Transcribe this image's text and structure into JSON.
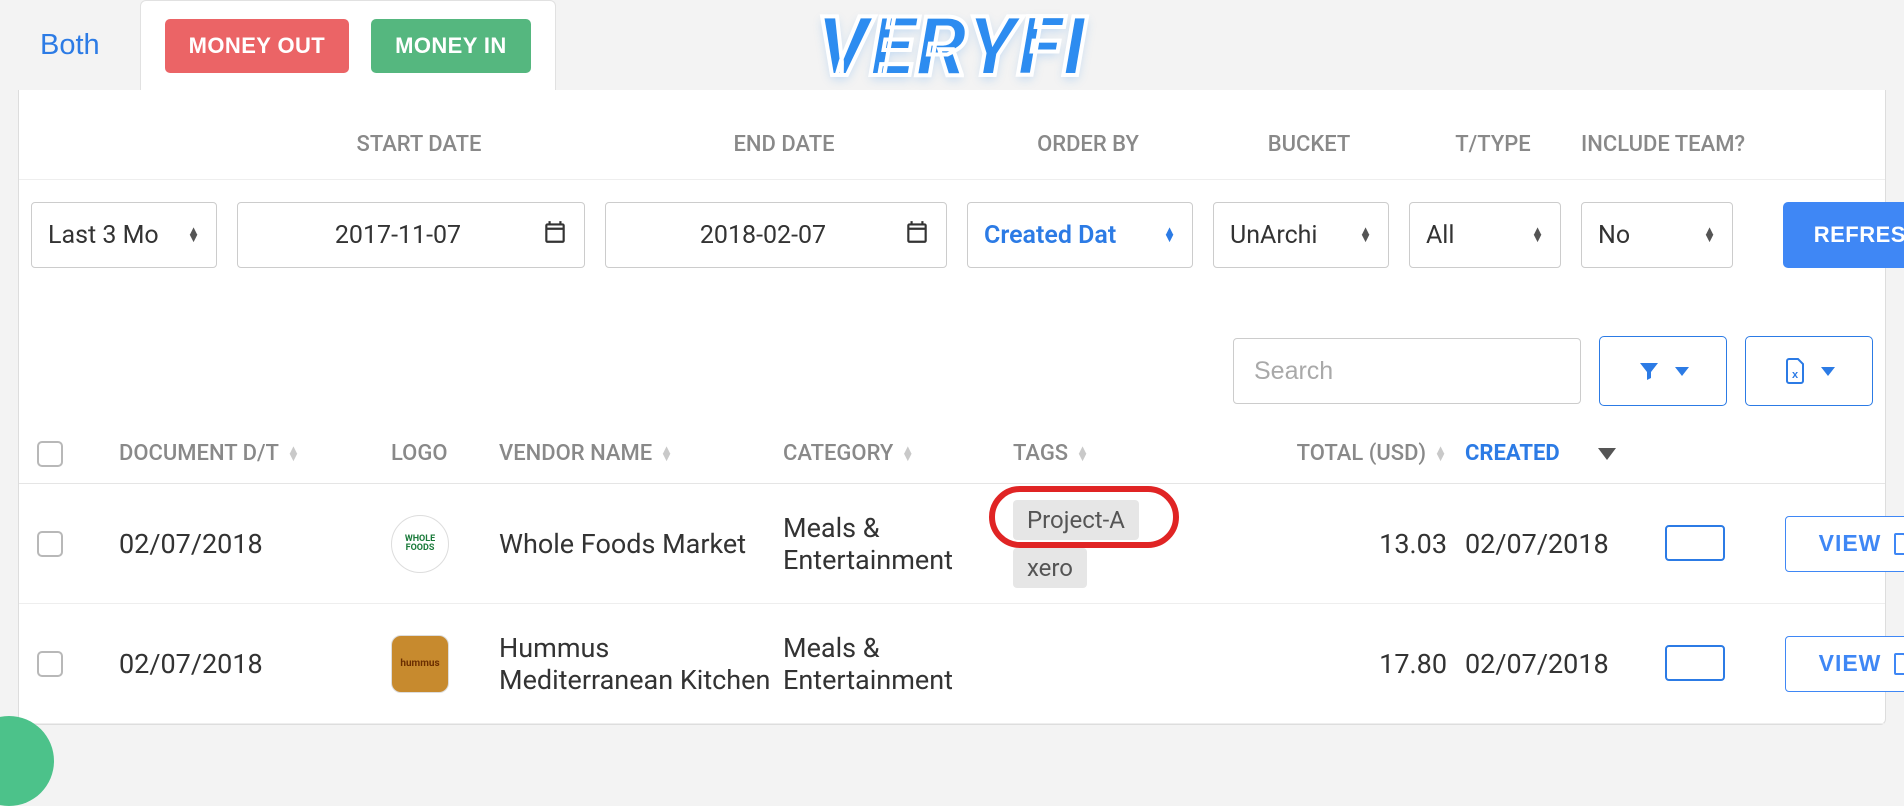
{
  "brand": "VERYFI",
  "tabs": {
    "both": "Both",
    "money_out": "MONEY OUT",
    "money_in": "MONEY IN"
  },
  "filters": {
    "labels": {
      "start_date": "START DATE",
      "end_date": "END DATE",
      "order_by": "ORDER BY",
      "bucket": "BUCKET",
      "ttype": "T/TYPE",
      "include_team": "INCLUDE TEAM?"
    },
    "range": "Last 3 Mo",
    "start_date": "2017-11-07",
    "end_date": "2018-02-07",
    "order_by": "Created Dat",
    "bucket": "UnArchi",
    "ttype": "All",
    "include_team": "No",
    "refresh": "REFRESH"
  },
  "search": {
    "placeholder": "Search"
  },
  "columns": {
    "document_dt": "DOCUMENT D/T",
    "logo": "LOGO",
    "vendor_name": "VENDOR NAME",
    "category": "CATEGORY",
    "tags": "TAGS",
    "total": "TOTAL (USD)",
    "created": "CREATED"
  },
  "rows": [
    {
      "date": "02/07/2018",
      "logo_text": "WHOLE FOODS",
      "logo_variant": "wf",
      "vendor": "Whole Foods Market",
      "category": "Meals & Entertainment",
      "tags": [
        "Project-A",
        "xero"
      ],
      "highlight_tag_index": 0,
      "total": "13.03",
      "created": "02/07/2018",
      "view": "VIEW"
    },
    {
      "date": "02/07/2018",
      "logo_text": "hummus",
      "logo_variant": "hum",
      "vendor": "Hummus Mediterranean Kitchen",
      "category": "Meals & Entertainment",
      "tags": [],
      "highlight_tag_index": -1,
      "total": "17.80",
      "created": "02/07/2018",
      "view": "VIEW"
    }
  ]
}
